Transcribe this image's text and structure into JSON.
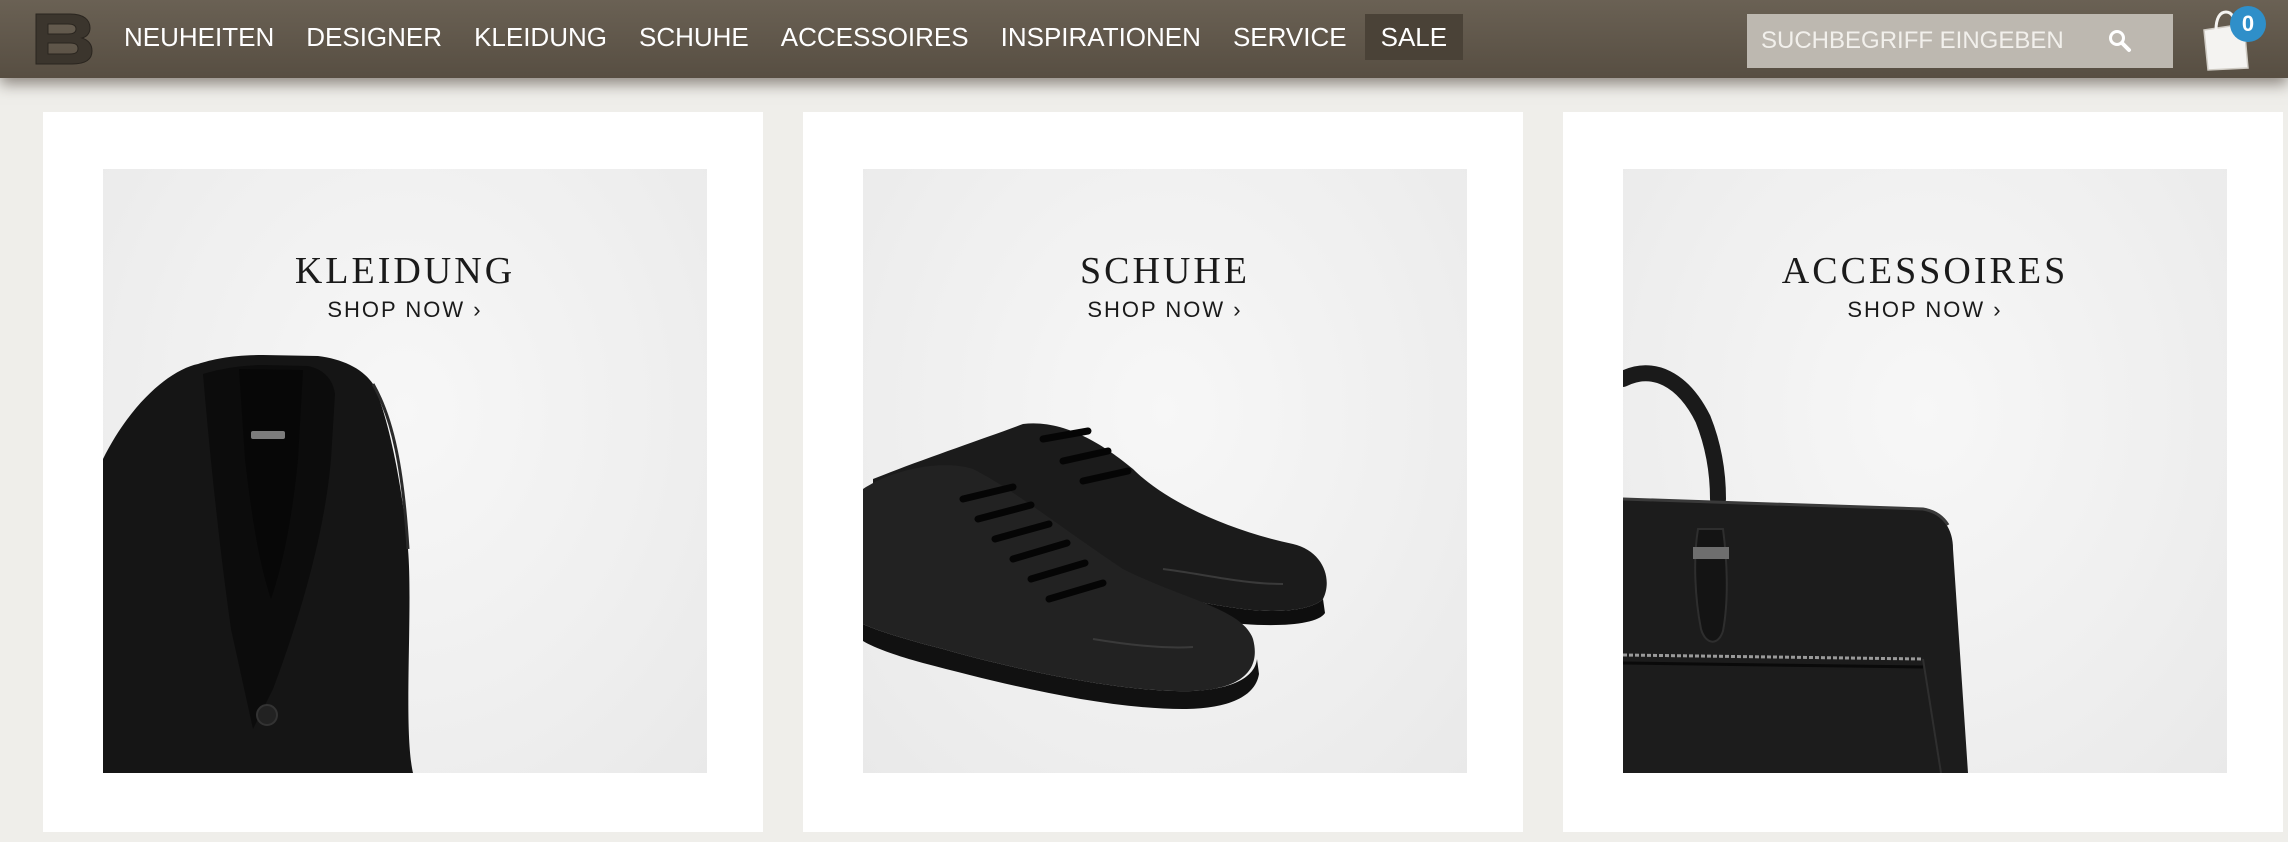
{
  "header": {
    "logo_letter": "B",
    "nav": [
      {
        "label": "NEUHEITEN"
      },
      {
        "label": "DESIGNER"
      },
      {
        "label": "KLEIDUNG"
      },
      {
        "label": "SCHUHE"
      },
      {
        "label": "ACCESSOIRES"
      },
      {
        "label": "INSPIRATIONEN"
      },
      {
        "label": "SERVICE"
      },
      {
        "label": "SALE"
      }
    ],
    "search": {
      "placeholder": "SUCHBEGRIFF EINGEBEN",
      "icon": "search-icon"
    },
    "cart": {
      "icon": "shopping-bag-icon",
      "count": "0"
    }
  },
  "categories": [
    {
      "title": "KLEIDUNG",
      "cta": "SHOP NOW ›",
      "image": "black-cardigan"
    },
    {
      "title": "SCHUHE",
      "cta": "SHOP NOW ›",
      "image": "black-leather-sneakers"
    },
    {
      "title": "ACCESSOIRES",
      "cta": "SHOP NOW ›",
      "image": "black-leather-bag"
    }
  ],
  "colors": {
    "header_bg": "#5f564a",
    "page_bg": "#efeeea",
    "badge": "#2f8fc9"
  }
}
